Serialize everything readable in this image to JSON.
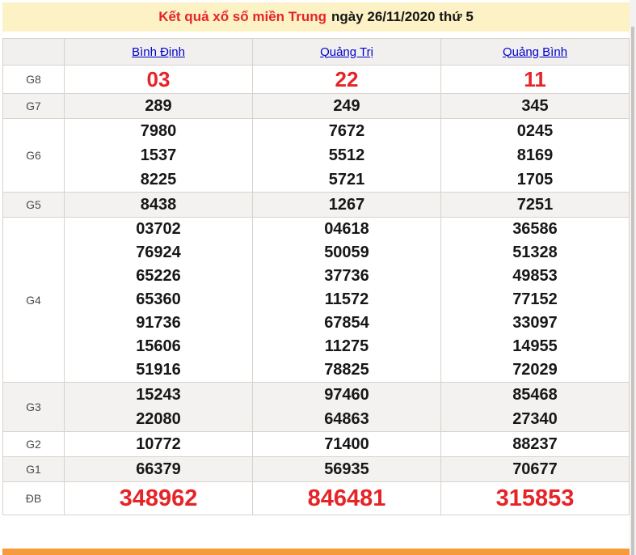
{
  "title": {
    "main": "Kết quả xổ số miền Trung",
    "date": "ngày 26/11/2020 thứ 5"
  },
  "table": {
    "columns": [
      {
        "key": "binh-dinh",
        "label": "Bình Định"
      },
      {
        "key": "quang-tri",
        "label": "Quảng Trị"
      },
      {
        "key": "quang-binh",
        "label": "Quảng Bình"
      }
    ],
    "rows": [
      {
        "key": "g8",
        "label": "G8",
        "style": "red-large",
        "values": [
          [
            "03"
          ],
          [
            "22"
          ],
          [
            "11"
          ]
        ]
      },
      {
        "key": "g7",
        "label": "G7",
        "values": [
          [
            "289"
          ],
          [
            "249"
          ],
          [
            "345"
          ]
        ]
      },
      {
        "key": "g6",
        "label": "G6",
        "values": [
          [
            "7980",
            "1537",
            "8225"
          ],
          [
            "7672",
            "5512",
            "5721"
          ],
          [
            "0245",
            "8169",
            "1705"
          ]
        ]
      },
      {
        "key": "g5",
        "label": "G5",
        "values": [
          [
            "8438"
          ],
          [
            "1267"
          ],
          [
            "7251"
          ]
        ]
      },
      {
        "key": "g4",
        "label": "G4",
        "style": "tight",
        "values": [
          [
            "03702",
            "76924",
            "65226",
            "65360",
            "91736",
            "15606",
            "51916"
          ],
          [
            "04618",
            "50059",
            "37736",
            "11572",
            "67854",
            "11275",
            "78825"
          ],
          [
            "36586",
            "51328",
            "49853",
            "77152",
            "33097",
            "14955",
            "72029"
          ]
        ]
      },
      {
        "key": "g3",
        "label": "G3",
        "values": [
          [
            "15243",
            "22080"
          ],
          [
            "97460",
            "64863"
          ],
          [
            "85468",
            "27340"
          ]
        ]
      },
      {
        "key": "g2",
        "label": "G2",
        "values": [
          [
            "10772"
          ],
          [
            "71400"
          ],
          [
            "88237"
          ]
        ]
      },
      {
        "key": "g1",
        "label": "G1",
        "values": [
          [
            "66379"
          ],
          [
            "56935"
          ],
          [
            "70677"
          ]
        ]
      },
      {
        "key": "db",
        "label": "ĐB",
        "style": "red-xlarge",
        "values": [
          [
            "348962"
          ],
          [
            "846481"
          ],
          [
            "315853"
          ]
        ]
      }
    ]
  },
  "colors": {
    "title_background": "#fcf2c5",
    "accent_red": "#e62428",
    "link_blue": "#0000cc",
    "header_background": "#f1f0ee",
    "alt_row_background": "#f3f2f0",
    "border": "#d9d2cb",
    "bottom_bar_orange": "#f79a3c"
  }
}
